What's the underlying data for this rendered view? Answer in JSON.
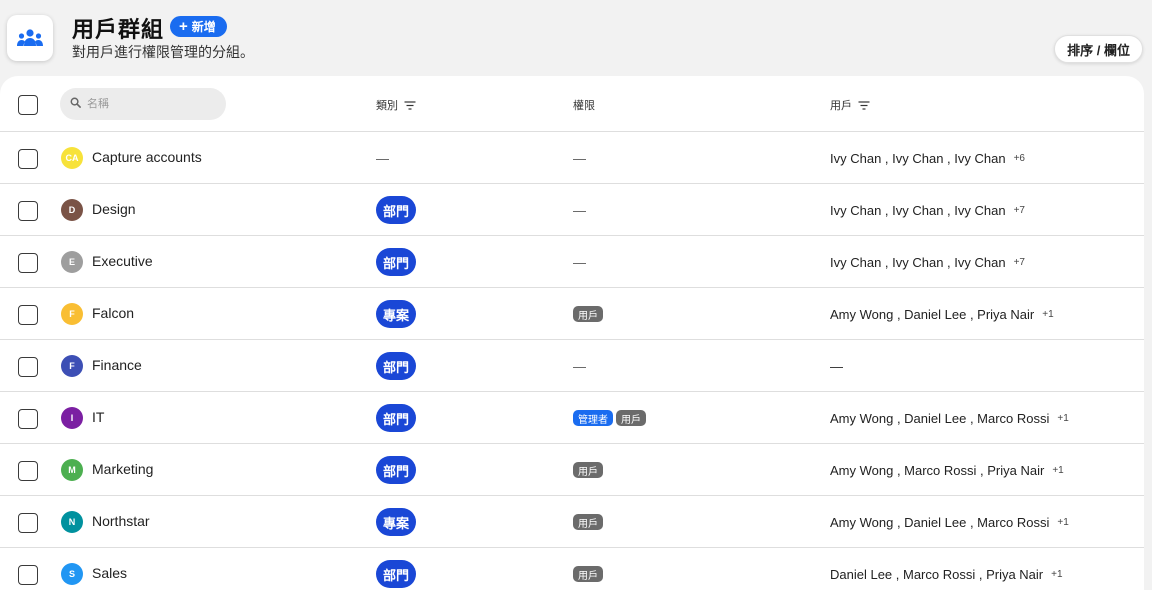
{
  "header": {
    "title": "用戶群組",
    "add_label": "新增",
    "subtitle": "對用戶進行權限管理的分組。",
    "sort_label": "排序 / 欄位"
  },
  "table": {
    "search_placeholder": "名稱",
    "columns": {
      "type": "類別",
      "permissions": "權限",
      "users": "用戶"
    },
    "rows": [
      {
        "initials": "CA",
        "color": "#f7e23a",
        "name": "Capture accounts",
        "type": "—",
        "permissions": [],
        "perm_empty": "—",
        "users": "Ivy Chan , Ivy Chan , Ivy Chan",
        "more": "+6"
      },
      {
        "initials": "D",
        "color": "#7a5346",
        "name": "Design",
        "type": "部門",
        "permissions": [],
        "perm_empty": "—",
        "users": "Ivy Chan , Ivy Chan , Ivy Chan",
        "more": "+7"
      },
      {
        "initials": "E",
        "color": "#9e9e9e",
        "name": "Executive",
        "type": "部門",
        "permissions": [],
        "perm_empty": "—",
        "users": "Ivy Chan , Ivy Chan , Ivy Chan",
        "more": "+7"
      },
      {
        "initials": "F",
        "color": "#f9be33",
        "name": "Falcon",
        "type": "專案",
        "permissions": [
          "用戶"
        ],
        "perm_empty": "",
        "users": "Amy Wong , Daniel Lee , Priya Nair",
        "more": "+1"
      },
      {
        "initials": "F",
        "color": "#3d4fb5",
        "name": "Finance",
        "type": "部門",
        "permissions": [],
        "perm_empty": "—",
        "users": "—",
        "more": ""
      },
      {
        "initials": "I",
        "color": "#7b1fa2",
        "name": "IT",
        "type": "部門",
        "permissions": [
          "管理者",
          "用戶"
        ],
        "perm_empty": "",
        "users": "Amy Wong , Daniel Lee , Marco Rossi",
        "more": "+1"
      },
      {
        "initials": "M",
        "color": "#4caf50",
        "name": "Marketing",
        "type": "部門",
        "permissions": [
          "用戶"
        ],
        "perm_empty": "",
        "users": "Amy Wong , Marco Rossi , Priya Nair",
        "more": "+1"
      },
      {
        "initials": "N",
        "color": "#00919e",
        "name": "Northstar",
        "type": "專案",
        "permissions": [
          "用戶"
        ],
        "perm_empty": "",
        "users": "Amy Wong , Daniel Lee , Marco Rossi",
        "more": "+1"
      },
      {
        "initials": "S",
        "color": "#2196f3",
        "name": "Sales",
        "type": "部門",
        "permissions": [
          "用戶"
        ],
        "perm_empty": "",
        "users": "Daniel Lee , Marco Rossi , Priya Nair",
        "more": "+1"
      }
    ]
  },
  "colors": {
    "accent": "#1a6cf0",
    "type_pill": "#1a47d6",
    "admin_badge": "#1a6cf0",
    "user_badge": "#6b6b6b"
  },
  "icons": {
    "app": "group-icon",
    "add": "plus-icon",
    "search": "search-icon",
    "filter": "filter-icon"
  }
}
